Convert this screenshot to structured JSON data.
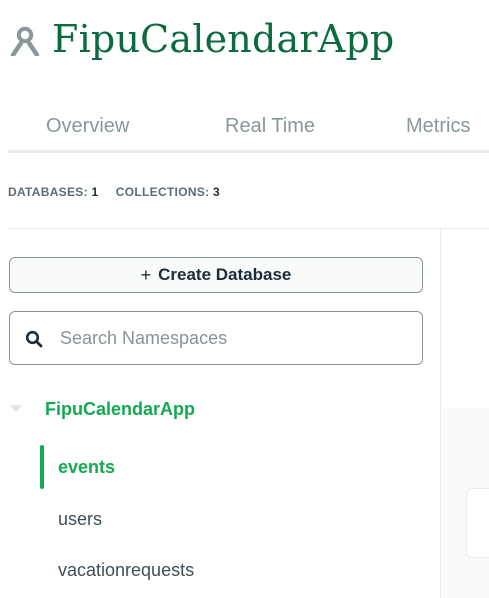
{
  "header": {
    "cluster_name": "FipuCalendarApp",
    "cluster_icon": "cluster-people-icon"
  },
  "tabs": [
    {
      "label": "Overview"
    },
    {
      "label": "Real Time"
    },
    {
      "label": "Metrics"
    }
  ],
  "stats": {
    "databases_label": "DATABASES:",
    "databases_count": "1",
    "collections_label": "COLLECTIONS:",
    "collections_count": "3"
  },
  "sidebar": {
    "create_button_label": "Create Database",
    "create_button_icon": "plus",
    "search_placeholder": "Search Namespaces",
    "search_value": "",
    "database": {
      "name": "FipuCalendarApp",
      "expanded": true,
      "collections": [
        {
          "label": "events",
          "active": true
        },
        {
          "label": "users",
          "active": false
        },
        {
          "label": "vacationrequests",
          "active": false
        }
      ]
    }
  },
  "colors": {
    "brand_dark_green": "#0b6b3f",
    "accent_green": "#13aa52",
    "muted_text": "#89979b",
    "border": "#889397"
  }
}
